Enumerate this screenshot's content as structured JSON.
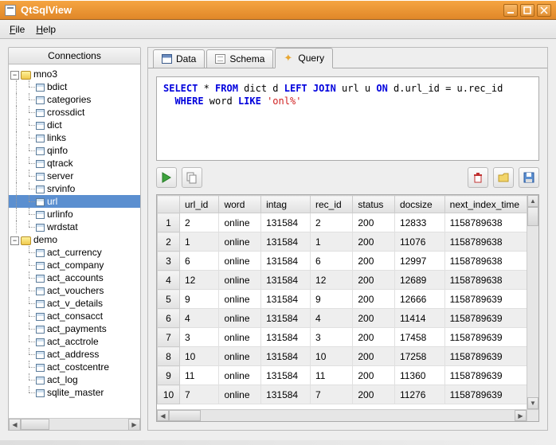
{
  "window": {
    "title": "QtSqlView"
  },
  "menu": {
    "file": "File",
    "help": "Help"
  },
  "sidebar": {
    "header": "Connections",
    "databases": [
      {
        "name": "mno3",
        "expanded": true,
        "tables": [
          "bdict",
          "categories",
          "crossdict",
          "dict",
          "links",
          "qinfo",
          "qtrack",
          "server",
          "srvinfo",
          "url",
          "urlinfo",
          "wrdstat"
        ],
        "selected": "url"
      },
      {
        "name": "demo",
        "expanded": true,
        "tables": [
          "act_currency",
          "act_company",
          "act_accounts",
          "act_vouchers",
          "act_v_details",
          "act_consacct",
          "act_payments",
          "act_acctrole",
          "act_address",
          "act_costcentre",
          "act_log",
          "sqlite_master"
        ]
      }
    ]
  },
  "tabs": {
    "data": "Data",
    "schema": "Schema",
    "query": "Query",
    "active": "query"
  },
  "sql": {
    "line1_pre": "SELECT",
    "line1_mid1": " * ",
    "line1_from": "FROM",
    "line1_mid2": " dict d ",
    "line1_lj": "LEFT",
    "line1_sp1": " ",
    "line1_join": "JOIN",
    "line1_mid3": " url u ",
    "line1_on": "ON",
    "line1_tail": " d.url_id = u.rec_id",
    "line2_indent": "  ",
    "line2_where": "WHERE",
    "line2_mid": " word ",
    "line2_like": "LIKE",
    "line2_sp": " ",
    "line2_str": "'onl%'"
  },
  "grid": {
    "columns": [
      "url_id",
      "word",
      "intag",
      "rec_id",
      "status",
      "docsize",
      "next_index_time"
    ],
    "rows": [
      [
        "2",
        "online",
        "131584",
        "2",
        "200",
        "12833",
        "1158789638"
      ],
      [
        "1",
        "online",
        "131584",
        "1",
        "200",
        "11076",
        "1158789638"
      ],
      [
        "6",
        "online",
        "131584",
        "6",
        "200",
        "12997",
        "1158789638"
      ],
      [
        "12",
        "online",
        "131584",
        "12",
        "200",
        "12689",
        "1158789638"
      ],
      [
        "9",
        "online",
        "131584",
        "9",
        "200",
        "12666",
        "1158789639"
      ],
      [
        "4",
        "online",
        "131584",
        "4",
        "200",
        "11414",
        "1158789639"
      ],
      [
        "3",
        "online",
        "131584",
        "3",
        "200",
        "17458",
        "1158789639"
      ],
      [
        "10",
        "online",
        "131584",
        "10",
        "200",
        "17258",
        "1158789639"
      ],
      [
        "11",
        "online",
        "131584",
        "11",
        "200",
        "11360",
        "1158789639"
      ],
      [
        "7",
        "online",
        "131584",
        "7",
        "200",
        "11276",
        "1158789639"
      ]
    ]
  }
}
